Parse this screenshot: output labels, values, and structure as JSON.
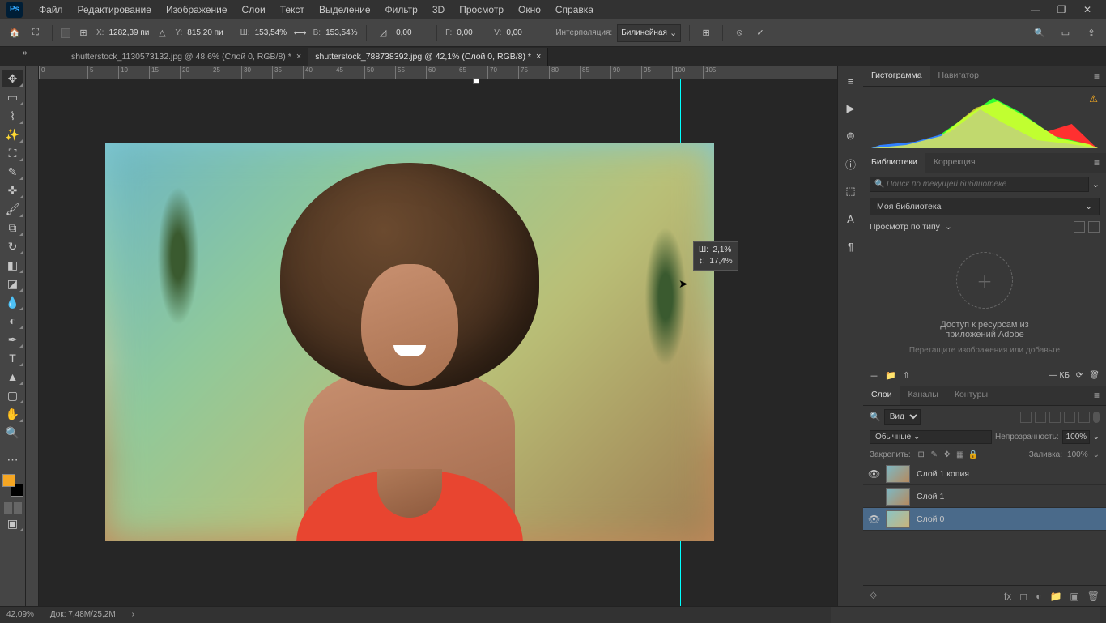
{
  "menu": [
    "Файл",
    "Редактирование",
    "Изображение",
    "Слои",
    "Текст",
    "Выделение",
    "Фильтр",
    "3D",
    "Просмотр",
    "Окно",
    "Справка"
  ],
  "options": {
    "x_label": "X:",
    "x": "1282,39 пи",
    "y_label": "Y:",
    "y": "815,20 пи",
    "w_label": "Ш:",
    "w": "153,54%",
    "h_label": "В:",
    "h": "153,54%",
    "angle": "0,00",
    "hskew_label": "Г:",
    "hskew": "0,00",
    "vskew_label": "V:",
    "vskew": "0,00",
    "interp_label": "Интерполяция:",
    "interp_value": "Бил­инейная"
  },
  "tabs": [
    {
      "title": "shutterstock_1130573132.jpg @ 48,6% (Слой 0, RGB/8) *",
      "active": false
    },
    {
      "title": "shutterstock_788738392.jpg @ 42,1% (Слой 0, RGB/8) *",
      "active": true
    }
  ],
  "ruler_ticks": [
    "0",
    "5",
    "10",
    "15",
    "20",
    "25",
    "30",
    "35",
    "40",
    "45",
    "50",
    "55",
    "60",
    "65",
    "70",
    "75",
    "80",
    "85",
    "90",
    "95",
    "100",
    "105"
  ],
  "tooltip": {
    "line1_label": "Ш:",
    "line1_val": "2,1%",
    "line2_label": "↕:",
    "line2_val": "17,4%"
  },
  "panels": {
    "hist_tabs": [
      "Гистограмма",
      "Навигатор"
    ],
    "lib_tabs": [
      "Библиотеки",
      "Коррекция"
    ],
    "search_placeholder": "Поиск по текущей библиотеке",
    "library_name": "Моя библиотека",
    "view_by": "Просмотр по типу",
    "empty_title_1": "Доступ к ресурсам из",
    "empty_title_2": "приложений Adobe",
    "empty_sub": "Перетащите изображения или добавьте",
    "kb_label": "— КБ",
    "layer_tabs": [
      "Слои",
      "Каналы",
      "Контуры"
    ],
    "layer_search_kind": "Вид",
    "blend_mode": "Обычные",
    "opacity_label": "Непрозрачность:",
    "opacity_val": "100%",
    "lock_label": "Закрепить:",
    "fill_label": "Заливка:",
    "fill_val": "100%",
    "layers": [
      {
        "name": "Слой 1 копия",
        "visible": true,
        "selected": false,
        "masked": true
      },
      {
        "name": "Слой 1",
        "visible": false,
        "selected": false,
        "masked": false
      },
      {
        "name": "Слой 0",
        "visible": true,
        "selected": true,
        "masked": false
      }
    ]
  },
  "status": {
    "zoom": "42,09%",
    "doc": "Док: 7,48M/25,2M"
  }
}
